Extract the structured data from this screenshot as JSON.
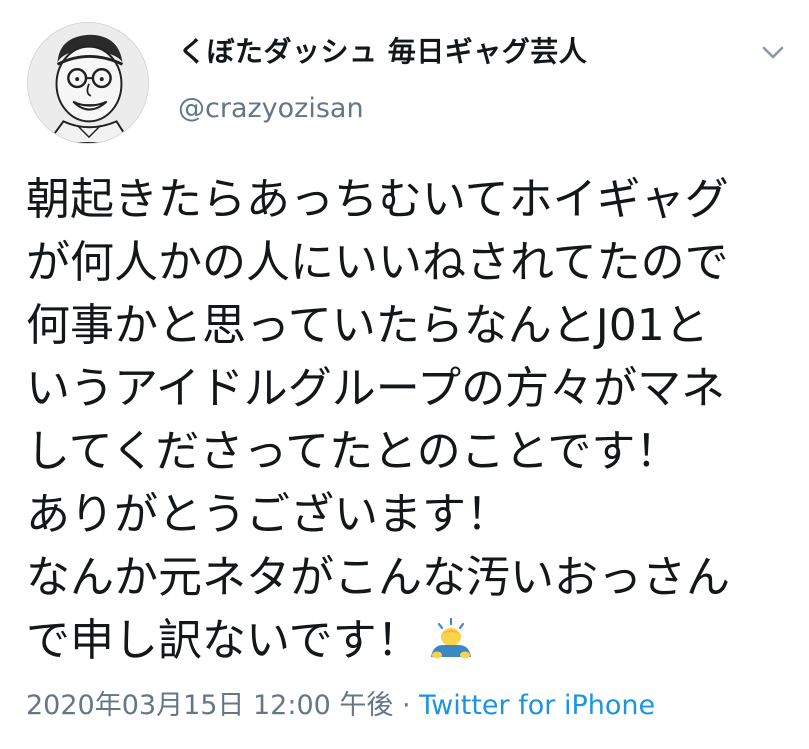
{
  "user": {
    "display_name": "くぼたダッシュ 毎日ギャグ芸人",
    "handle": "@crazyozisan"
  },
  "tweet": {
    "text": "朝起きたらあっちむいてホイギャグ\nが何人かの人にいいねされてたので\n何事かと思っていたらなんとJ01と\nいうアイドルグループの方々がマネ\nしてくださってたとのことです！\nありがとうございます！\nなんか元ネタがこんな汚いおっさん\nで申し訳ないです！",
    "emoji": "person-bowing-emoji",
    "timestamp": "2020年03月15日 12:00 午後",
    "separator": " · ",
    "source": "Twitter for iPhone"
  },
  "icons": {
    "menu": "chevron-down-icon"
  },
  "colors": {
    "text": "#14171a",
    "secondary": "#657786",
    "link": "#1b95e0"
  }
}
